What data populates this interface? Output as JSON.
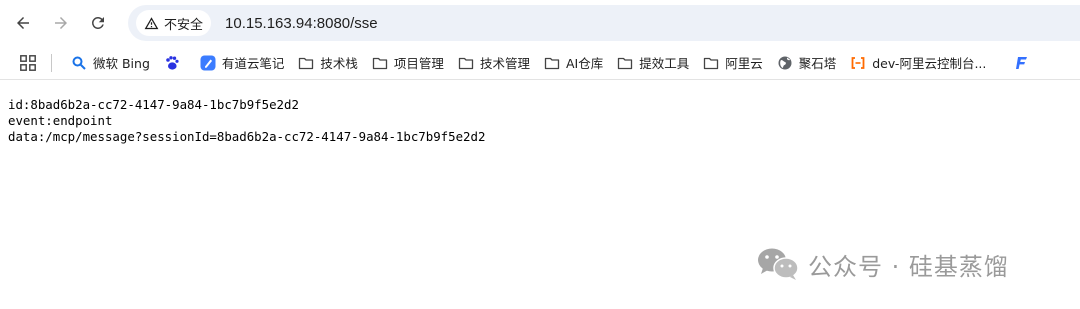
{
  "toolbar": {
    "back_icon": "arrow-left-icon",
    "forward_icon": "arrow-right-icon",
    "reload_icon": "reload-icon",
    "security_label": "不安全",
    "url": "10.15.163.94:8080/sse"
  },
  "bookmarks": {
    "items": [
      {
        "label": "微软 Bing",
        "icon": "search-icon"
      },
      {
        "label": "",
        "icon": "baidu-paw-icon"
      },
      {
        "label": "有道云笔记",
        "icon": "youdao-note-icon"
      },
      {
        "label": "技术栈",
        "icon": "folder-icon"
      },
      {
        "label": "项目管理",
        "icon": "folder-icon"
      },
      {
        "label": "技术管理",
        "icon": "folder-icon"
      },
      {
        "label": "AI仓库",
        "icon": "folder-icon"
      },
      {
        "label": "提效工具",
        "icon": "folder-icon"
      },
      {
        "label": "阿里云",
        "icon": "folder-icon"
      },
      {
        "label": "聚石塔",
        "icon": "globe-icon"
      },
      {
        "label": "dev-阿里云控制台...",
        "icon": "aliyun-icon"
      },
      {
        "label": "",
        "icon": "feishu-f-icon"
      }
    ]
  },
  "content": {
    "lines": [
      "id:8bad6b2a-cc72-4147-9a84-1bc7b9f5e2d2",
      "event:endpoint",
      "data:/mcp/message?sessionId=8bad6b2a-cc72-4147-9a84-1bc7b9f5e2d2"
    ]
  },
  "watermark": {
    "text": "公众号 · 硅基蒸馏",
    "icon": "wechat-icon"
  },
  "colors": {
    "omnibox_bg": "#edf1f8",
    "bing_blue": "#1a73e8",
    "baidu_blue": "#2932e1",
    "youdao_blue": "#3b7cff",
    "aliyun_orange": "#ff6a00",
    "feishu_blue": "#3370ff"
  }
}
